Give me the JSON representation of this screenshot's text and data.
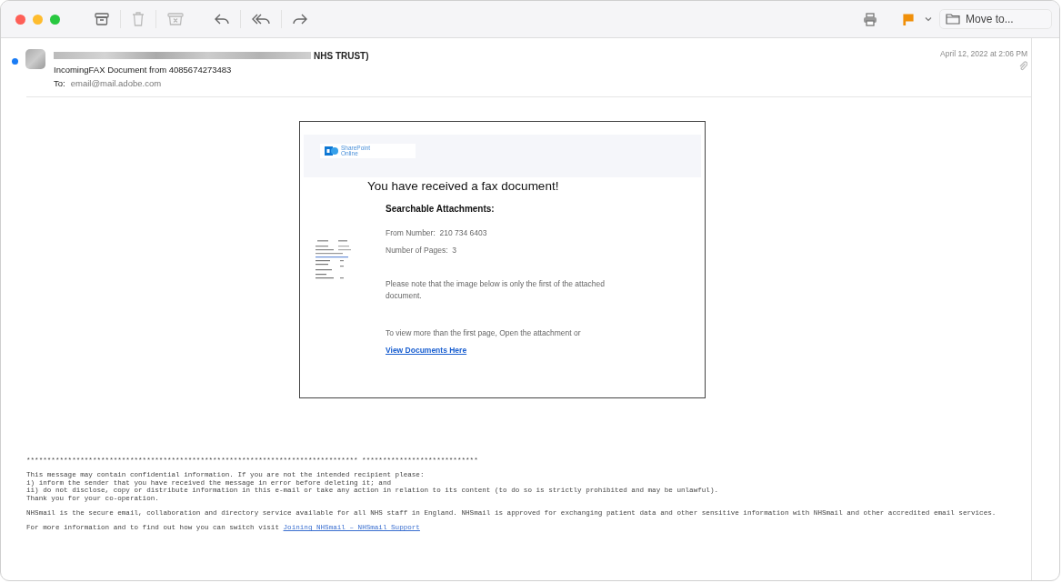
{
  "toolbar": {
    "flagged": true,
    "move_button": "Move to..."
  },
  "message": {
    "unread": true,
    "sender": "NHS TRUST)",
    "subject": "IncomingFAX Document from 4085674273483",
    "to_label": "To:",
    "to": "email@mail.adobe.com",
    "date": "April 12, 2022 at 2:06 PM",
    "has_attachment": true
  },
  "fax_card": {
    "logo_text": [
      "SharePoint",
      "Online"
    ],
    "heading": "You have received a fax document!",
    "subheading": "Searchable Attachments:",
    "from_number": "From Number:  210 734 6403",
    "pages": "Number of Pages:  3",
    "note": "Please note that the image below is only the first of the attached document.",
    "view_more": "To view more than the first page, Open the attachment or",
    "link": "View Documents Here"
  },
  "footer": {
    "separator": "******************************************************************************** ****************************",
    "disclaimer": [
      "This message may contain confidential information. If you are not the intended recipient please:",
      "i) inform the sender that you have received the message in error before deleting it; and",
      "ii) do not disclose, copy or distribute information in this e-mail or take any action in relation to its content (to do so is strictly prohibited and may be unlawful).",
      "Thank you for your co-operation."
    ],
    "about": "NHSmail is the secure email, collaboration and directory service available for all NHS staff in England. NHSmail is approved for exchanging patient data and other sensitive information with NHSmail and other accredited email services.",
    "more_info": "For more information and to find out how you can switch visit",
    "more_link": "Joining NHSmail – NHSmail Support"
  }
}
